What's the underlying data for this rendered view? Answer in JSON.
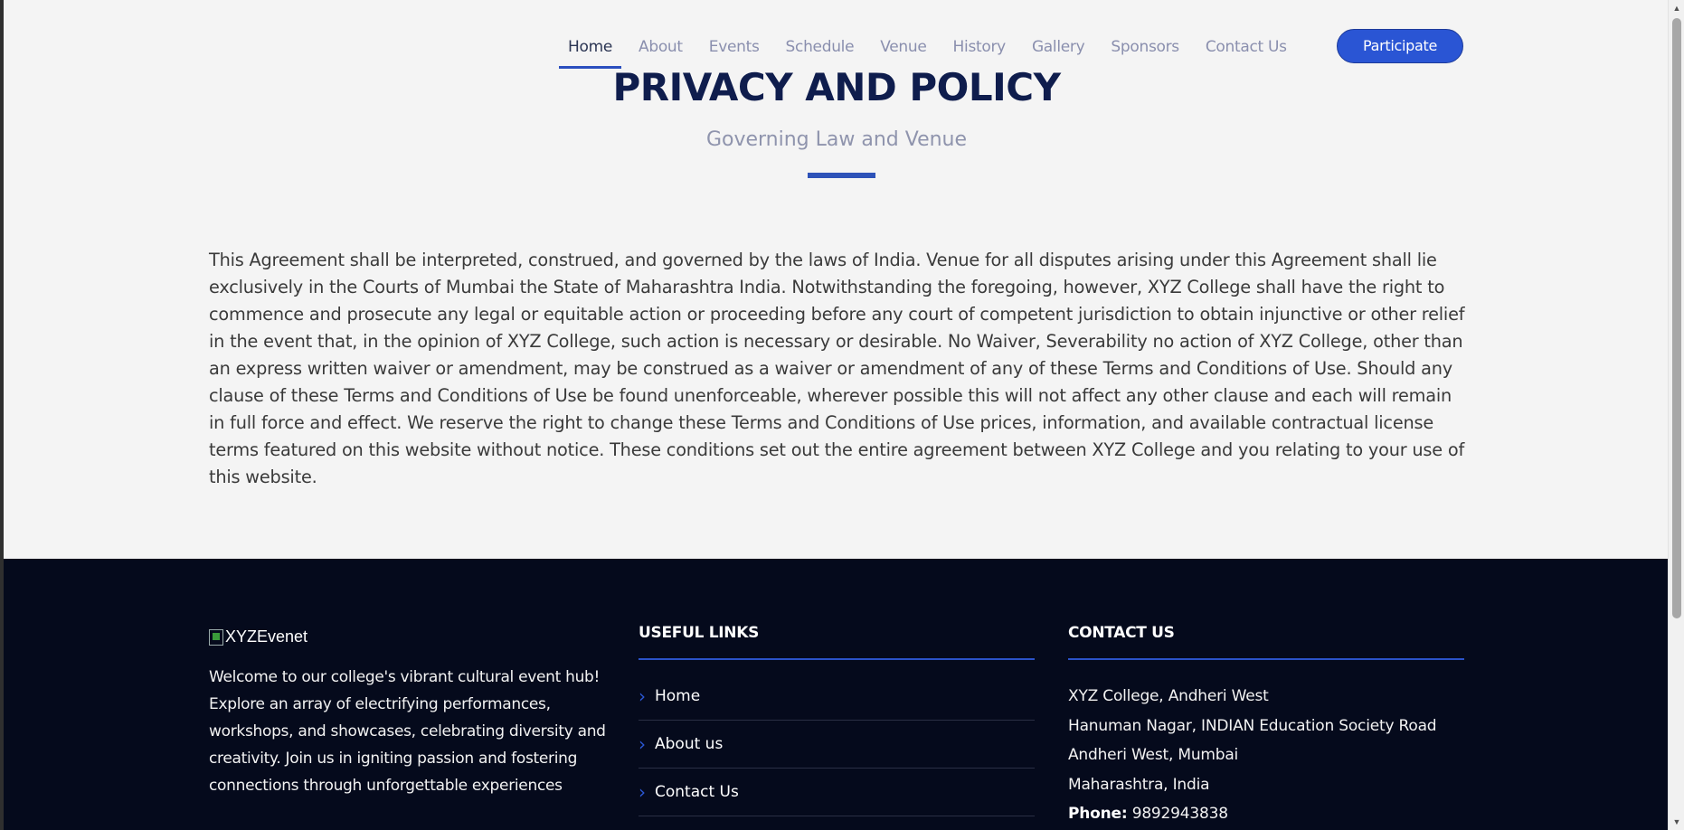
{
  "nav": {
    "items": [
      "Home",
      "About",
      "Events",
      "Schedule",
      "Venue",
      "History",
      "Gallery",
      "Sponsors",
      "Contact Us"
    ],
    "active": "Home",
    "cta": "Participate"
  },
  "header": {
    "title": "PRIVACY AND POLICY",
    "subtitle": "Governing Law and Venue"
  },
  "main": {
    "body": "This Agreement shall be interpreted, construed, and governed by the laws of India. Venue for all disputes arising under this Agreement shall lie exclusively in the Courts of Mumbai the State of Maharashtra India. Notwithstanding the foregoing, however, XYZ College shall have the right to commence and prosecute any legal or equitable action or proceeding before any court of competent jurisdiction to obtain injunctive or other relief in the event that, in the opinion of XYZ College, such action is necessary or desirable. No Waiver, Severability no action of XYZ College, other than an express written waiver or amendment, may be construed as a waiver or amendment of any of these Terms and Conditions of Use. Should any clause of these Terms and Conditions of Use be found unenforceable, wherever possible this will not affect any other clause and each will remain in full force and effect. We reserve the right to change these Terms and Conditions of Use prices, information, and available contractual license terms featured on this website without notice. These conditions set out the entire agreement between XYZ College and you relating to your use of this website."
  },
  "footer": {
    "logo_alt": "XYZEvenet",
    "description": "Welcome to our college's vibrant cultural event hub! Explore an array of electrifying performances, workshops, and showcases, celebrating diversity and creativity. Join us in igniting passion and fostering connections through unforgettable experiences",
    "useful_links_heading": "USEFUL LINKS",
    "useful_links": [
      "Home",
      "About us",
      "Contact Us"
    ],
    "contact_heading": "CONTACT US",
    "contact_lines": [
      "XYZ College, Andheri West",
      "Hanuman Nagar, INDIAN Education Society Road",
      "Andheri West, Mumbai",
      "Maharashtra, India"
    ],
    "phone_label": "Phone:",
    "phone": "9892943838"
  },
  "colors": {
    "accent": "#2a55d4",
    "title": "#0f1d4d",
    "footer_bg": "#050a1c"
  },
  "icons": [
    "chevron-right-icon",
    "broken-image-icon"
  ]
}
